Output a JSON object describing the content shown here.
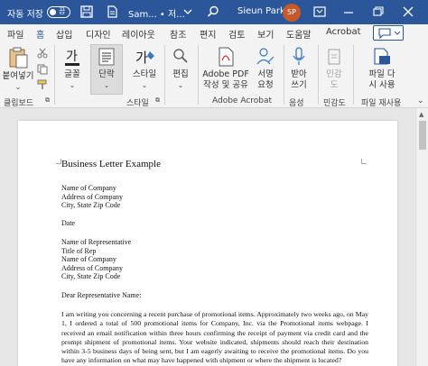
{
  "titlebar": {
    "autosave_label": "자동 저장",
    "autosave_state": "끔",
    "doc_name": "Sam... • 저...",
    "user_name": "Sieun Park",
    "user_initials": "SP"
  },
  "tabs": [
    "파일",
    "홈",
    "삽입",
    "디자인",
    "레이아웃",
    "참조",
    "편지",
    "검토",
    "보기",
    "도움말",
    "Acrobat"
  ],
  "active_tab": "홈",
  "ribbon": {
    "paste": "붙여넣기",
    "clipboard_group": "클립보드",
    "font": "글꼴",
    "paragraph": "단락",
    "styles": "스타일",
    "styles_group": "스타일",
    "editing": "편집",
    "adobe_pdf": [
      "Adobe PDF",
      "작성 및 공유"
    ],
    "signature": [
      "서명",
      "요청"
    ],
    "adobe_group": "Adobe Acrobat",
    "dictate": [
      "받아",
      "쓰기"
    ],
    "voice_group": "음성",
    "sensitivity": [
      "민감",
      "도"
    ],
    "sensitivity_group": "민감도",
    "reuse_file": [
      "파일 다",
      "시 사용"
    ],
    "reuse_group": "파일 재사용"
  },
  "document": {
    "title": "Business Letter Example",
    "sender": [
      "Name of Company",
      "Address of Company",
      "City, State Zip Code"
    ],
    "date": "Date",
    "recipient": [
      "Name of Representative",
      "Title of Rep",
      "Name of Company",
      "Address of Company",
      "City, State Zip Code"
    ],
    "salutation": "Dear Representative Name:",
    "body": "I am writing you concerning a recent purchase of promotional items. Approximately two weeks ago, on May 1, I ordered a total of 500 promotional items for Company, Inc. via the Promotional items webpage. I received an email notification within three hours confirming the receipt of payment via credit card and the prompt shipment of promotional items. Your website indicated, shipments should reach their destination within 3-5 business days of being sent, but I am eagerly awaiting to receive the promotional items. Do you have any information on what may have happened with shipment or where the shipment is located?"
  }
}
